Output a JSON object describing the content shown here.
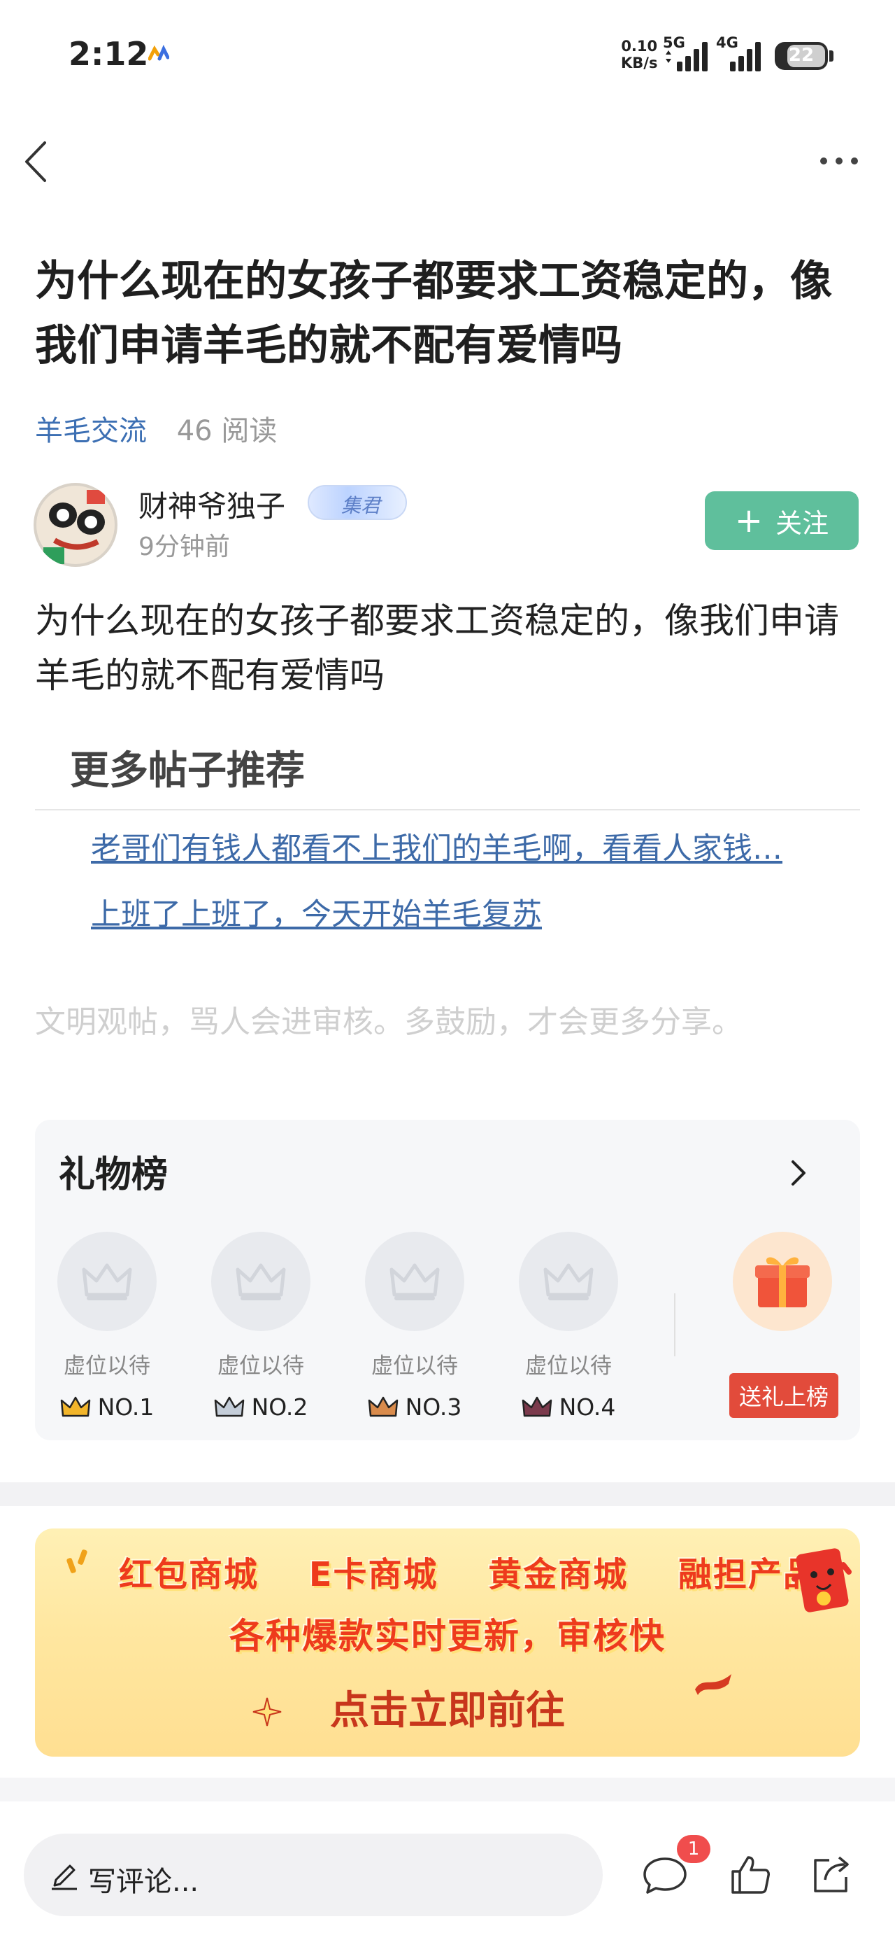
{
  "status_bar": {
    "time": "2:12",
    "net_speed_value": "0.10",
    "net_speed_unit": "KB/s",
    "signal_1_label": "5G",
    "signal_2_label": "4G",
    "battery": "22"
  },
  "post": {
    "title": "为什么现在的女孩子都要求工资稳定的，像我们申请羊毛的就不配有爱情吗",
    "category": "羊毛交流",
    "reads": "46 阅读",
    "author_name": "财神爷独子",
    "author_badge": "集君",
    "time_ago": "9分钟前",
    "follow_label": "关注",
    "follow_plus": "+",
    "content": "为什么现在的女孩子都要求工资稳定的，像我们申请羊毛的就不配有爱情吗"
  },
  "recommend": {
    "title": "更多帖子推荐",
    "links": [
      "老哥们有钱人都看不上我们的羊毛啊，看看人家钱…",
      "上班了上班了，今天开始羊毛复苏"
    ]
  },
  "notice": "文明观帖，骂人会进审核。多鼓励，才会更多分享。",
  "gift_board": {
    "title": "礼物榜",
    "slots": [
      {
        "label": "虚位以待",
        "rank": "NO.1",
        "crown_color": "#f2b52b"
      },
      {
        "label": "虚位以待",
        "rank": "NO.2",
        "crown_color": "#9aa8bd"
      },
      {
        "label": "虚位以待",
        "rank": "NO.3",
        "crown_color": "#d98b4c"
      },
      {
        "label": "虚位以待",
        "rank": "NO.4",
        "crown_color": "#7b3a4c"
      }
    ],
    "send_label": "送礼上榜"
  },
  "banner": {
    "items": [
      "红包商城",
      "E卡商城",
      "黄金商城",
      "融担产品"
    ],
    "subtitle": "各种爆款实时更新，审核快",
    "cta": "点击立即前往"
  },
  "bottom_bar": {
    "comment_placeholder": "写评论...",
    "comment_count": "1"
  },
  "colors": {
    "accent_green": "#5fbf9c",
    "link_blue": "#3d6aa8",
    "red": "#e24b3b"
  }
}
